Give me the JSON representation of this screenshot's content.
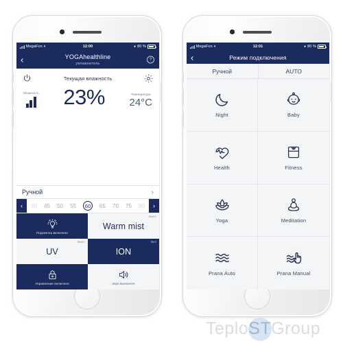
{
  "watermark": {
    "part1": "Teplo",
    "logo": "ST",
    "part2": "Group"
  },
  "phone_left": {
    "status": {
      "carrier": "MegaFon",
      "wifi": "wifi-icon",
      "time": "12:00",
      "battery": "80 %"
    },
    "nav": {
      "back": "‹",
      "title": "YOGAhealthline",
      "subtitle": "увлажнитель",
      "help": "?"
    },
    "dashboard": {
      "power_icon": "power-icon",
      "title": "Текущая влажность",
      "settings_icon": "gear-icon",
      "power_label": "Мощность",
      "humidity_value": "23%",
      "temp_label": "Температура",
      "temp_value": "24°C"
    },
    "mode_row": {
      "label": "Ручной",
      "chevron": "›"
    },
    "slider": {
      "prev": "‹",
      "next": "›",
      "values": [
        "40",
        "45",
        "50",
        "55",
        "60",
        "65",
        "70",
        "75",
        "80"
      ],
      "selected": "60"
    },
    "tiles": [
      {
        "name": "backlight",
        "style": "dark",
        "icon": "lightbulb-icon",
        "caption": "Подсветка включена",
        "badge": ""
      },
      {
        "name": "warm-mist",
        "style": "light",
        "text": "Warm mist",
        "badge": "Выкл"
      },
      {
        "name": "uv",
        "style": "light",
        "text": "UV",
        "badge": "Выкл"
      },
      {
        "name": "ion",
        "style": "dark",
        "text": "ION",
        "badge": "Вкл"
      },
      {
        "name": "child-lock",
        "style": "dark",
        "icon": "lock-icon",
        "caption": "Управление включено",
        "badge": ""
      },
      {
        "name": "sound",
        "style": "light",
        "icon": "speaker-icon",
        "caption": "Звук выключен",
        "badge": ""
      }
    ]
  },
  "phone_right": {
    "status": {
      "carrier": "MegaFon",
      "wifi": "wifi-icon",
      "time": "12:01",
      "battery": "80 %"
    },
    "nav": {
      "back": "‹",
      "title": "Режим подключения"
    },
    "segments": [
      {
        "label": "Ручной"
      },
      {
        "label": "AUTO"
      }
    ],
    "modes": [
      {
        "label": "Night",
        "icon": "moon-icon"
      },
      {
        "label": "Baby",
        "icon": "baby-face-icon"
      },
      {
        "label": "Health",
        "icon": "heart-pulse-icon"
      },
      {
        "label": "Fitness",
        "icon": "scale-icon"
      },
      {
        "label": "Yoga",
        "icon": "lotus-icon"
      },
      {
        "label": "Meditation",
        "icon": "meditation-icon"
      },
      {
        "label": "Prana Auto",
        "icon": "waves-icon"
      },
      {
        "label": "Prana Manual",
        "icon": "waves-hand-icon"
      }
    ]
  }
}
